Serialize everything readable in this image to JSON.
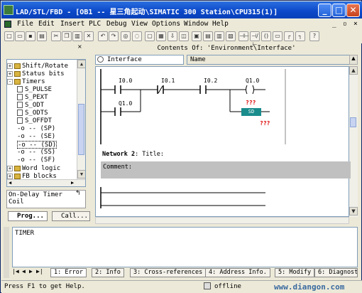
{
  "window": {
    "title": "LAD/STL/FBD  - [OB1 -- 星三角起动\\SIMATIC 300 Station\\CPU315(1)]"
  },
  "menu": [
    "File",
    "Edit",
    "Insert",
    "PLC",
    "Debug",
    "View",
    "Options",
    "Window",
    "Help"
  ],
  "window_buttons": {
    "minimize": "_",
    "maximize": "□",
    "close": "✕"
  },
  "mdi_buttons": [
    "_",
    "▫",
    "×"
  ],
  "interface": {
    "header": "Contents Of: 'Environment\\Interface'",
    "combo_value": "Interface",
    "name_col": "Name"
  },
  "tree": [
    {
      "label": "Shift/Rotate",
      "expander": "+",
      "kind": "folder"
    },
    {
      "label": "Status bits",
      "expander": "+",
      "kind": "folder"
    },
    {
      "label": "Timers",
      "expander": "-",
      "kind": "folder"
    },
    {
      "label": "S_PULSE",
      "kind": "block"
    },
    {
      "label": "S_PEXT",
      "kind": "block"
    },
    {
      "label": "S_ODT",
      "kind": "block"
    },
    {
      "label": "S_ODTS",
      "kind": "block"
    },
    {
      "label": "S_OFFDT",
      "kind": "block"
    },
    {
      "label": "-o -- (SP)",
      "kind": "coil"
    },
    {
      "label": "-o -- (SE)",
      "kind": "coil"
    },
    {
      "label": "-o -- (SD)",
      "kind": "coil",
      "selected": true
    },
    {
      "label": "-o -- (SS)",
      "kind": "coil"
    },
    {
      "label": "-o -- (SF)",
      "kind": "coil"
    },
    {
      "label": "Word logic",
      "expander": "+",
      "kind": "folder"
    },
    {
      "label": "FB blocks",
      "expander": "+",
      "kind": "folder"
    }
  ],
  "detail": {
    "line1": "On-Delay Timer",
    "line2": "Coil"
  },
  "left_tabs": [
    "Prog...",
    "Call..."
  ],
  "ladder": {
    "contacts": [
      "I0.0",
      "I0.1",
      "I0.2",
      "Q1.0"
    ],
    "coil": "Q1.0",
    "sd_label": "SD",
    "unknown1": "???",
    "unknown2": "???"
  },
  "network2": {
    "label": "Network 2",
    "title_label": ": Title:",
    "comment_label": "Comment:"
  },
  "output": {
    "text": "TIMER"
  },
  "output_tabs": [
    "1: Error",
    "2: Info",
    "3: Cross-references",
    "4: Address Info.",
    "5: Modify",
    "6: Diagnost"
  ],
  "status": {
    "help": "Press F1 to get Help.",
    "mode": "offline",
    "watermark": "www.diangon.com"
  }
}
